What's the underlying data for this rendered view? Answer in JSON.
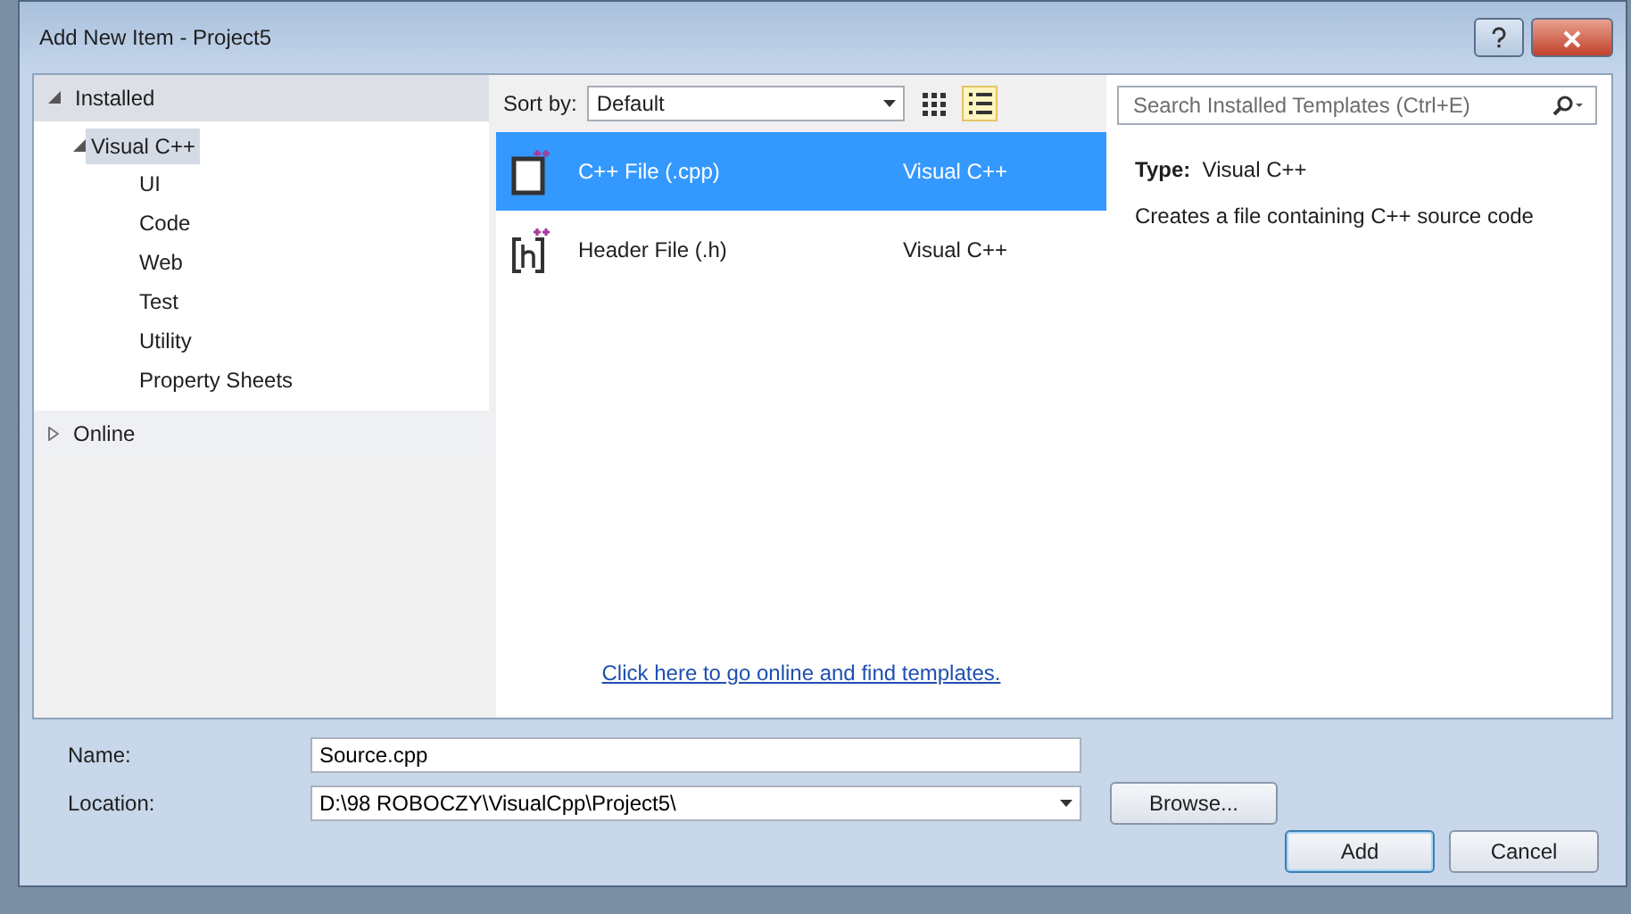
{
  "window": {
    "title": "Add New Item - Project5"
  },
  "tree": [
    {
      "label": "Installed",
      "kind": "header",
      "expanded": true,
      "children": [
        {
          "label": "Visual C++",
          "expanded": true,
          "selected": true,
          "children": [
            {
              "label": "UI",
              "selected": false
            },
            {
              "label": "Code",
              "selected": false
            },
            {
              "label": "Web",
              "selected": false
            },
            {
              "label": "Test",
              "selected": false
            },
            {
              "label": "Utility",
              "selected": false
            },
            {
              "label": "Property Sheets",
              "selected": false
            }
          ]
        }
      ]
    },
    {
      "label": "Online",
      "kind": "header",
      "expanded": false
    }
  ],
  "toolbar": {
    "sort_label": "Sort by:",
    "sort_value": "Default",
    "views": [
      {
        "kind": "grid",
        "selected": false
      },
      {
        "kind": "list",
        "selected": true
      }
    ]
  },
  "search": {
    "placeholder": "Search Installed Templates (Ctrl+E)"
  },
  "templates": [
    {
      "kind": "cpp",
      "name": "C++ File (.cpp)",
      "type": "Visual C++",
      "selected": true
    },
    {
      "kind": "header",
      "name": "Header File (.h)",
      "type": "Visual C++",
      "selected": false
    }
  ],
  "online_link": "Click here to go online and find templates.",
  "details": {
    "type": "**Type:**  Visual C++",
    "description": "Creates a file containing C++ source code"
  },
  "fields": [
    {
      "label": "Name:",
      "value": "Source.cpp",
      "kind": "text"
    },
    {
      "label": "Location:",
      "value": "D:\\98 ROBOCZY\\VisualCpp\\Project5\\",
      "kind": "combo"
    }
  ],
  "browse": "Browse...",
  "buttons": [
    {
      "label": "Add",
      "default": true
    },
    {
      "label": "Cancel",
      "default": false
    }
  ]
}
